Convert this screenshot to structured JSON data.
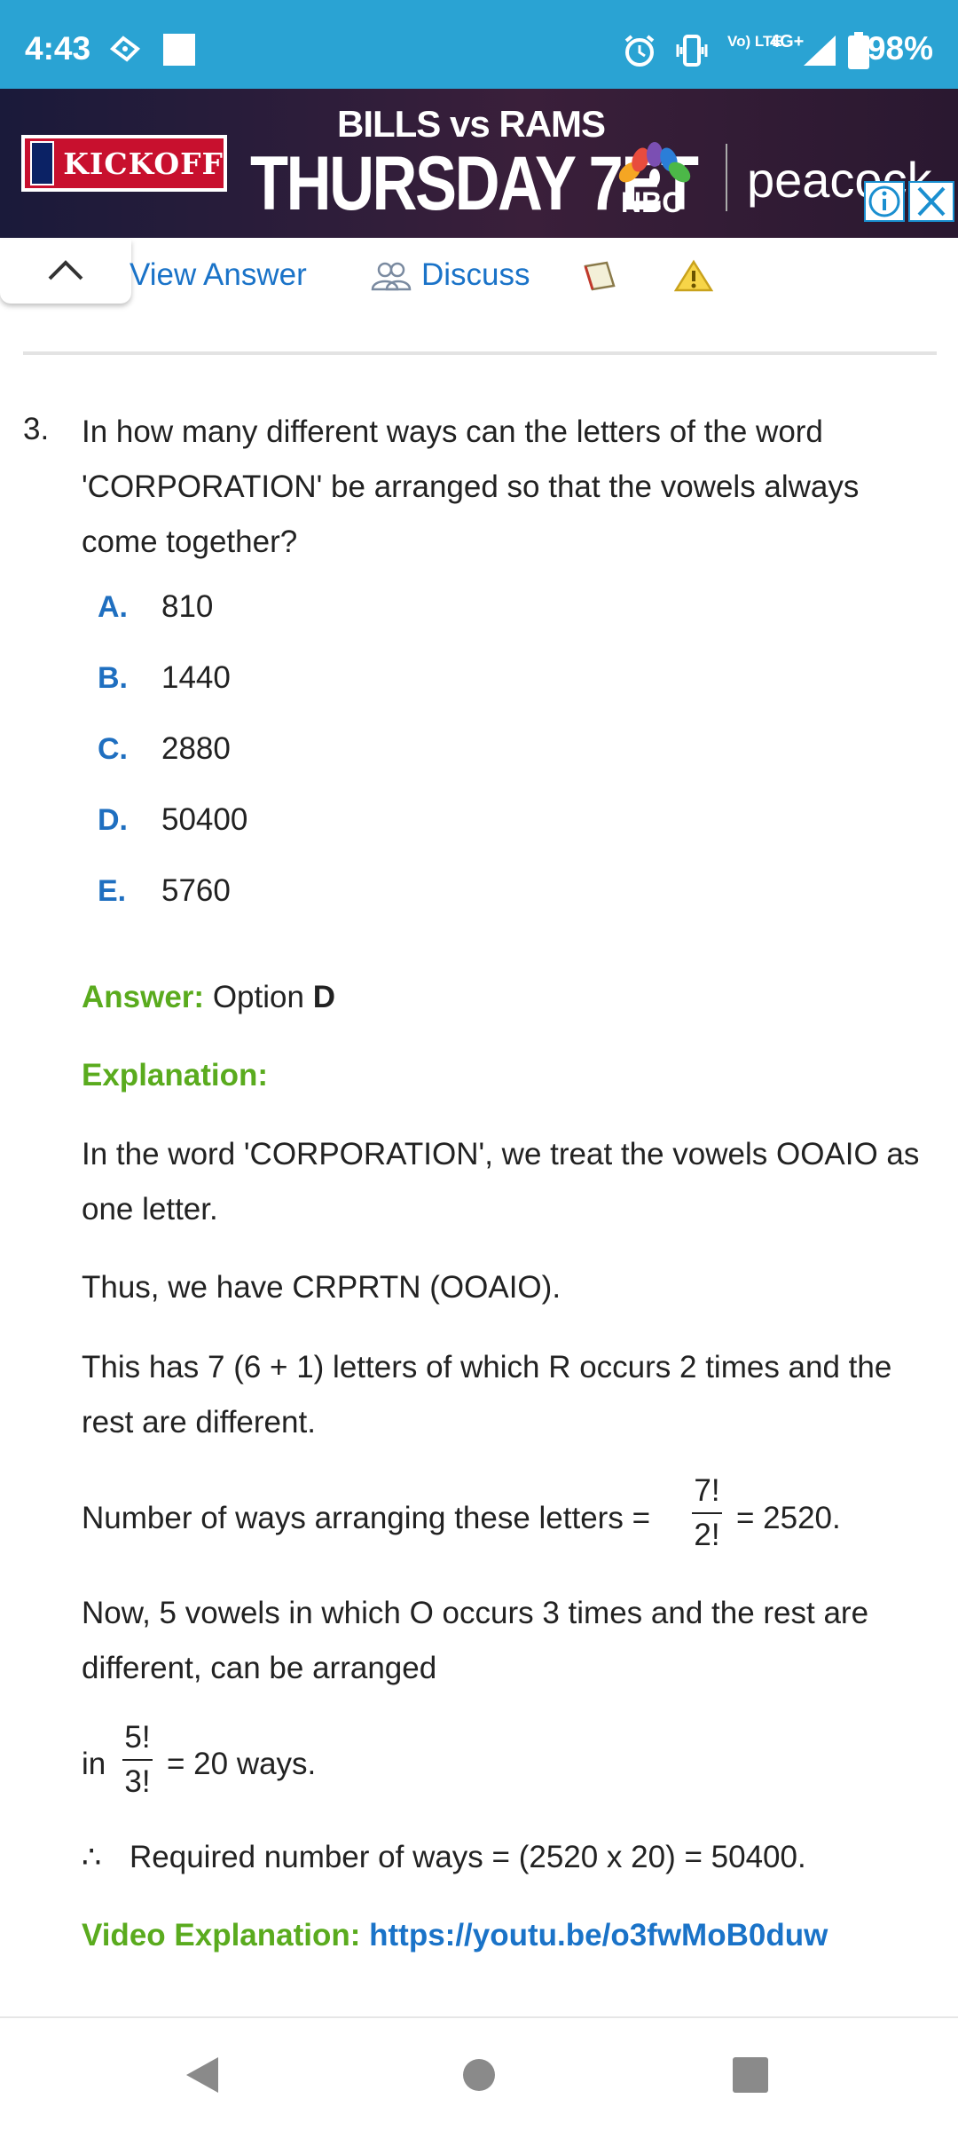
{
  "status_bar": {
    "time": "4:43",
    "battery": "98%",
    "network": "4G+",
    "volte": "Vo) LTE",
    "icons": [
      "gmail-icon",
      "square-icon",
      "alarm-icon",
      "vibrate-icon",
      "signal-icon",
      "battery-icon"
    ]
  },
  "ad": {
    "kickoff": "KICKOFF",
    "matchup": "BILLS vs RAMS",
    "headline": "THURSDAY 7ET",
    "network": "NBC",
    "streaming": "peacock"
  },
  "toolbar": {
    "view_answer": "View Answer",
    "discuss": "Discuss"
  },
  "question": {
    "number": "3.",
    "text": "In how many different ways can the letters of the word 'CORPORATION' be arranged so that the vowels always come together?",
    "options": [
      {
        "letter": "A.",
        "value": "810"
      },
      {
        "letter": "B.",
        "value": "1440"
      },
      {
        "letter": "C.",
        "value": "2880"
      },
      {
        "letter": "D.",
        "value": "50400"
      },
      {
        "letter": "E.",
        "value": "5760"
      }
    ]
  },
  "answer": {
    "label": "Answer:",
    "prefix": "Option",
    "option": "D"
  },
  "explanation": {
    "label": "Explanation:",
    "p1": "In the word 'CORPORATION', we treat the vowels OOAIO as one letter.",
    "p2": "Thus, we have CRPRTN (OOAIO).",
    "p3": "This has 7 (6 + 1) letters of which R occurs 2 times and the rest are different.",
    "p4_prefix": "Number of ways arranging these letters =",
    "p4_num": "7!",
    "p4_den": "2!",
    "p4_result": "= 2520.",
    "p5": "Now, 5 vowels in which O occurs 3 times and the rest are different, can be arranged",
    "p6_prefix": "in",
    "p6_num": "5!",
    "p6_den": "3!",
    "p6_result": "= 20 ways.",
    "therefore": "∴",
    "p7": "Required number of ways = (2520 x 20) = 50400.",
    "video_label": "Video Explanation:",
    "video_url": "https://youtu.be/o3fwMoB0duw"
  },
  "colors": {
    "status_bar": "#2aa3d3",
    "link_blue": "#1a73c8",
    "option_blue": "#1f6fc0",
    "label_green": "#5aab1e"
  }
}
